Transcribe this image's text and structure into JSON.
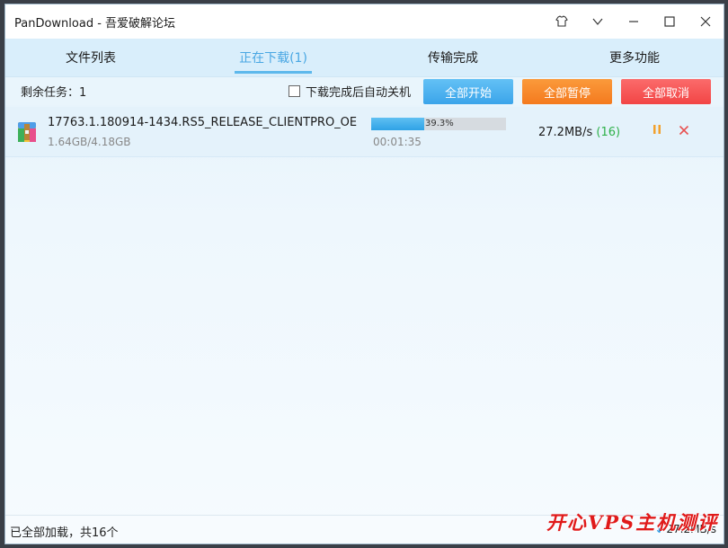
{
  "window": {
    "title": "PanDownload - 吾爱破解论坛"
  },
  "tabs": [
    {
      "label": "文件列表"
    },
    {
      "label": "正在下载(1)"
    },
    {
      "label": "传输完成"
    },
    {
      "label": "更多功能"
    }
  ],
  "toolbar": {
    "remaining": "剩余任务：1",
    "shutdown_label": "下载完成后自动关机",
    "shutdown_checked": false,
    "start_all": "全部开始",
    "pause_all": "全部暂停",
    "cancel_all": "全部取消"
  },
  "download": {
    "filename": "17763.1.180914-1434.RS5_RELEASE_CLIENTPRO_OE...",
    "size": "1.64GB/4.18GB",
    "progress": 0.393,
    "progress_text": "39.3%",
    "elapsed": "00:01:35",
    "speed": "27.2MB/s",
    "connections": "(16)"
  },
  "status": {
    "left": "已全部加载，共16个",
    "speed": "27.2MB/s"
  },
  "watermark": "开心VPS主机测评"
}
